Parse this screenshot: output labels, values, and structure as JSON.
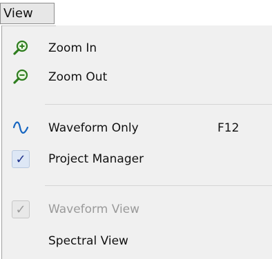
{
  "menubar": {
    "title": "View"
  },
  "menu": {
    "items": [
      {
        "label": "Zoom In",
        "icon": "zoom-in-icon",
        "enabled": true
      },
      {
        "label": "Zoom Out",
        "icon": "zoom-out-icon",
        "enabled": true
      },
      {
        "label": "Waveform Only",
        "icon": "waveform-icon",
        "shortcut": "F12",
        "enabled": true
      },
      {
        "label": "Project Manager",
        "icon": "checkmark-icon",
        "checked": true,
        "enabled": true
      },
      {
        "label": "Waveform View",
        "icon": "checkmark-icon",
        "checked": true,
        "enabled": false
      },
      {
        "label": "Spectral View",
        "enabled": true
      }
    ]
  },
  "colors": {
    "menu_background": "#f0f0f0",
    "zoom_icon": "#2e7d1e",
    "waveform_icon": "#1565c0",
    "check": "#1c2f8a",
    "disabled_text": "#9a9a9a"
  }
}
